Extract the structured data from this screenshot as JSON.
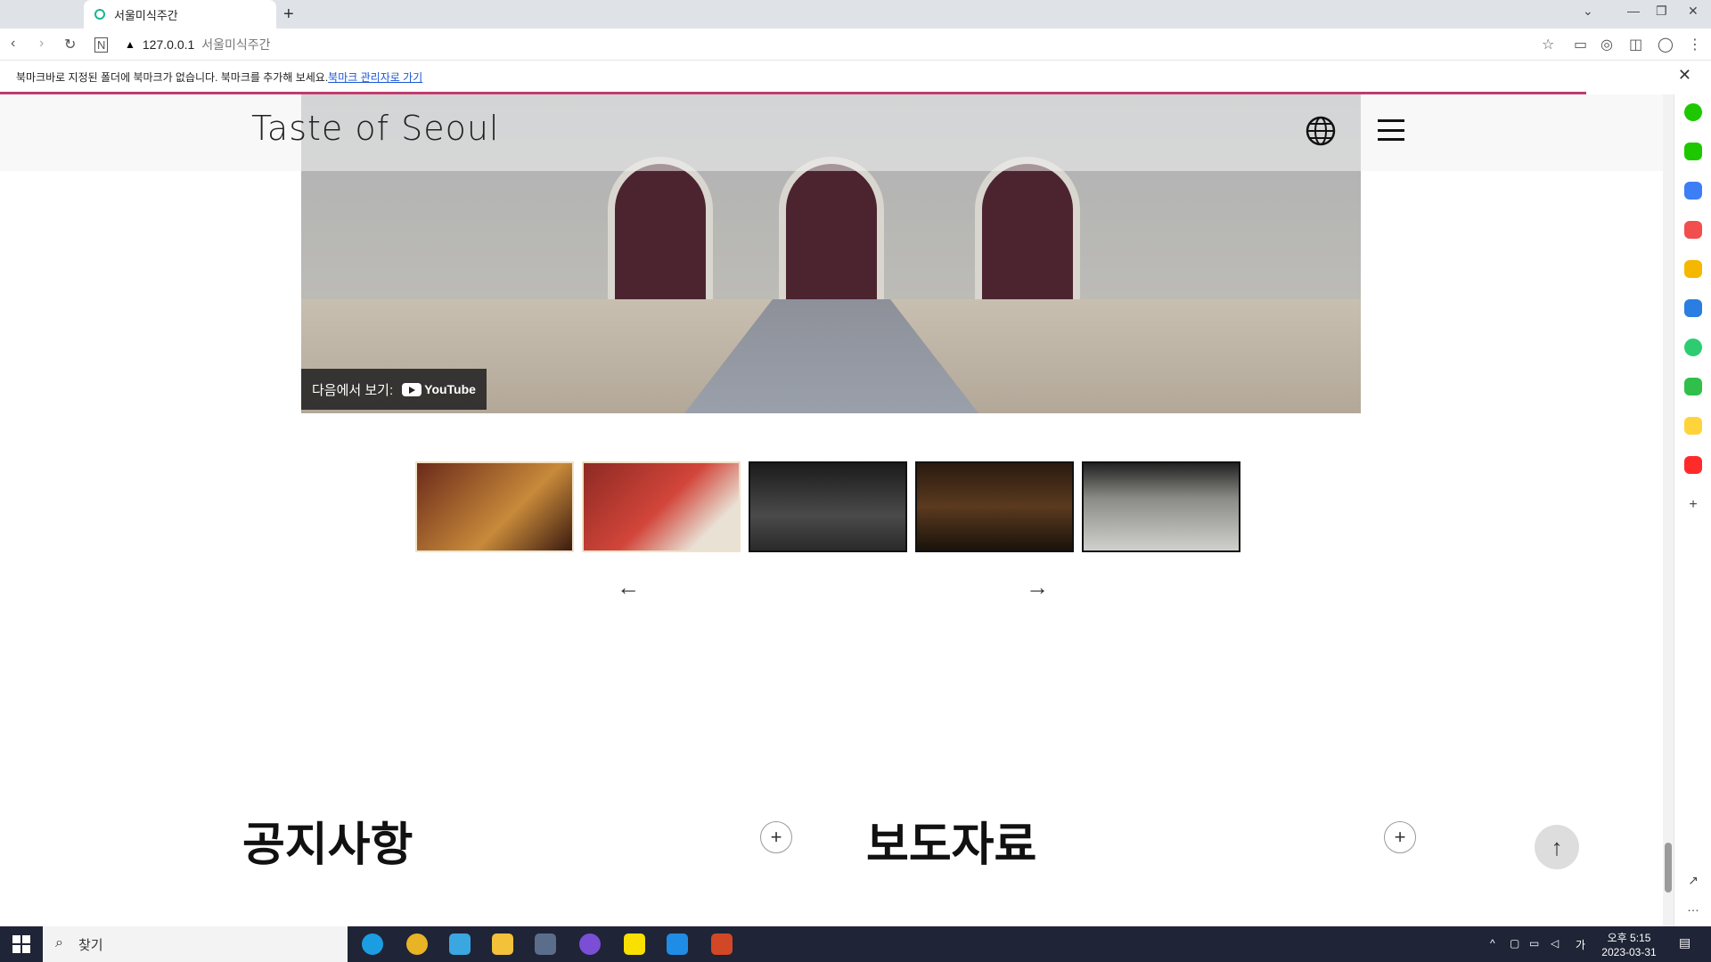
{
  "browser": {
    "tab_title": "서울미식주간",
    "url_host": "127.0.0.1",
    "url_title": "서울미식주간",
    "bookmark_notice": "북마크바로 지정된 폴더에 북마크가 없습니다. 북마크를 추가해 보세요.",
    "bookmark_link": "북마크 관리자로 가기"
  },
  "site": {
    "logo": "Taste of Seoul",
    "video_watch_on": "다음에서 보기:",
    "video_brand": "YouTube"
  },
  "thumbnails": [
    "thumb-1",
    "thumb-2",
    "thumb-3",
    "thumb-4",
    "thumb-5"
  ],
  "sections": {
    "notice_title": "공지사항",
    "press_title": "보도자료"
  },
  "taskbar": {
    "search_placeholder": "찾기",
    "time": "오후 5:15",
    "date": "2023-03-31",
    "ime": "가"
  },
  "icons": {
    "prev": "arrow-left-icon",
    "next": "arrow-right-icon",
    "globe": "globe-icon",
    "menu": "hamburger-icon",
    "top": "arrow-up-icon"
  }
}
